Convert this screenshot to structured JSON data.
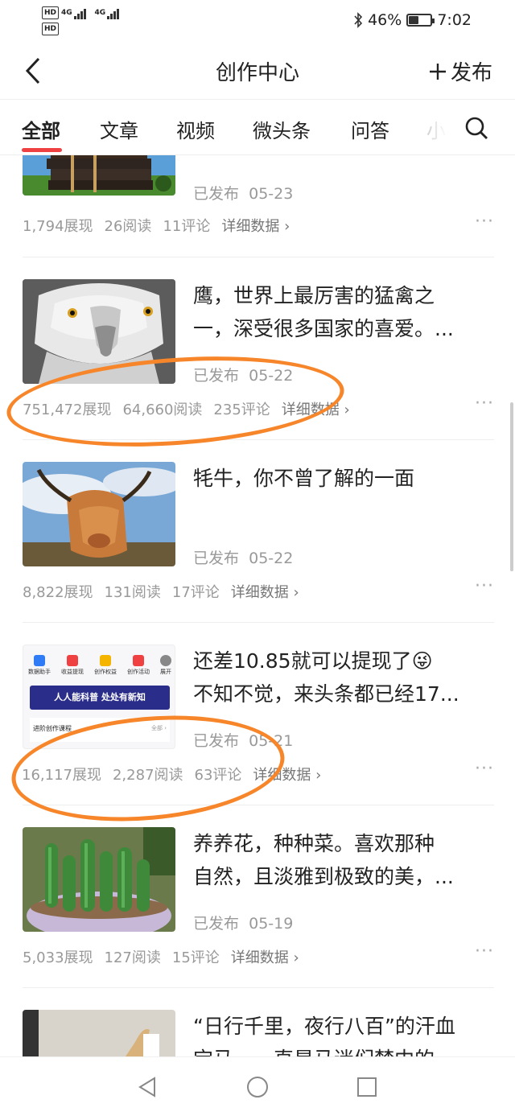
{
  "status_bar": {
    "network1": "HD",
    "network2": "HD",
    "net_type1": "4G",
    "net_type2": "4G",
    "battery_percent": "46%",
    "time": "7:02",
    "battery_level": 0.46
  },
  "header": {
    "title": "创作中心",
    "publish_label": "发布"
  },
  "tabs": [
    {
      "label": "全部",
      "active": true
    },
    {
      "label": "文章",
      "active": false
    },
    {
      "label": "视频",
      "active": false
    },
    {
      "label": "微头条",
      "active": false
    },
    {
      "label": "问答",
      "active": false
    },
    {
      "label": "小",
      "active": false
    }
  ],
  "articles": [
    {
      "title_lines": [],
      "status": "已发布",
      "date": "05-23",
      "impressions": "1,794展现",
      "reads": "26阅读",
      "comments": "11评论",
      "detail": "详细数据 ›",
      "more": "···",
      "thumb": "books"
    },
    {
      "title_lines": [
        "鹰，世界上最厉害的猛禽之",
        "一，深受很多国家的喜爱。..."
      ],
      "status": "已发布",
      "date": "05-22",
      "impressions": "751,472展现",
      "reads": "64,660阅读",
      "comments": "235评论",
      "detail": "详细数据 ›",
      "more": "···",
      "thumb": "eagle"
    },
    {
      "title_lines": [
        "牦牛，你不曾了解的一面"
      ],
      "status": "已发布",
      "date": "05-22",
      "impressions": "8,822展现",
      "reads": "131阅读",
      "comments": "17评论",
      "detail": "详细数据 ›",
      "more": "···",
      "thumb": "yak"
    },
    {
      "title_lines": [
        "还差10.85就可以提现了😜",
        "不知不觉，来头条都已经17..."
      ],
      "status": "已发布",
      "date": "05-21",
      "impressions": "16,117展现",
      "reads": "2,287阅读",
      "comments": "63评论",
      "detail": "详细数据 ›",
      "more": "···",
      "thumb": "app",
      "thumb_text": {
        "icons": [
          "数据助手",
          "收益提现",
          "创作权益",
          "创作活动",
          "展开"
        ],
        "banner": "人人能科普 处处有新知",
        "course": "进阶创作课程",
        "all": "全部 ›"
      }
    },
    {
      "title_lines": [
        "养养花，种种菜。喜欢那种",
        "自然，且淡雅到极致的美，..."
      ],
      "status": "已发布",
      "date": "05-19",
      "impressions": "5,033展现",
      "reads": "127阅读",
      "comments": "15评论",
      "detail": "详细数据 ›",
      "more": "···",
      "thumb": "cactus"
    },
    {
      "title_lines": [
        "“日行千里，夜行八百”的汗血",
        "宝马，一直是马迷们梦中的"
      ],
      "thumb": "horse"
    }
  ],
  "colors": {
    "accent": "#f04142",
    "annotation": "#f7862a",
    "meta": "#999999"
  }
}
